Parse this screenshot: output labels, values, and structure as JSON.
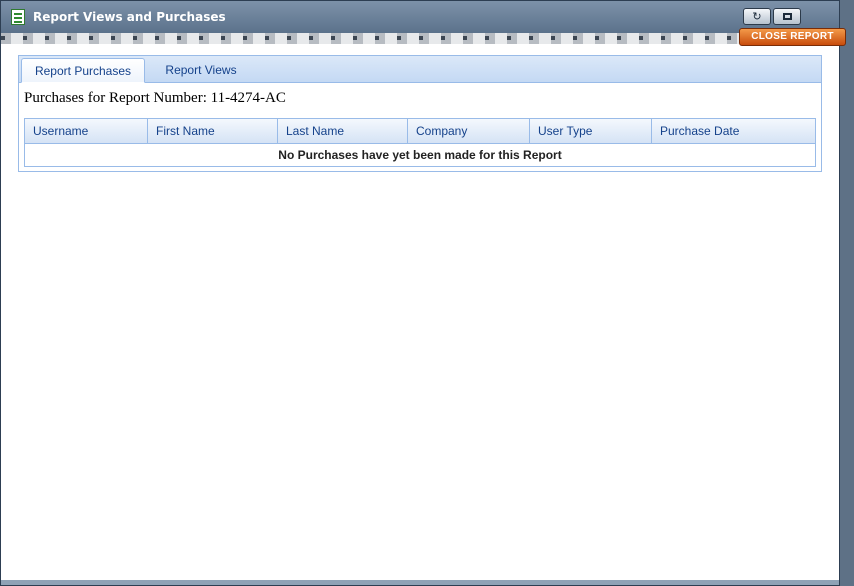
{
  "window": {
    "title": "Report Views and Purchases",
    "close_label": "CLOSE REPORT"
  },
  "tabs": [
    {
      "label": "Report Purchases",
      "active": true
    },
    {
      "label": "Report Views",
      "active": false
    }
  ],
  "report": {
    "heading": "Purchases for Report Number: 11-4274-AC"
  },
  "grid": {
    "columns": [
      "Username",
      "First Name",
      "Last Name",
      "Company",
      "User Type",
      "Purchase Date"
    ],
    "empty_message": "No Purchases have yet been made for this Report"
  },
  "colors": {
    "accent": "#15428b",
    "close_button": "#e06a1e",
    "border": "#99bbe8"
  }
}
